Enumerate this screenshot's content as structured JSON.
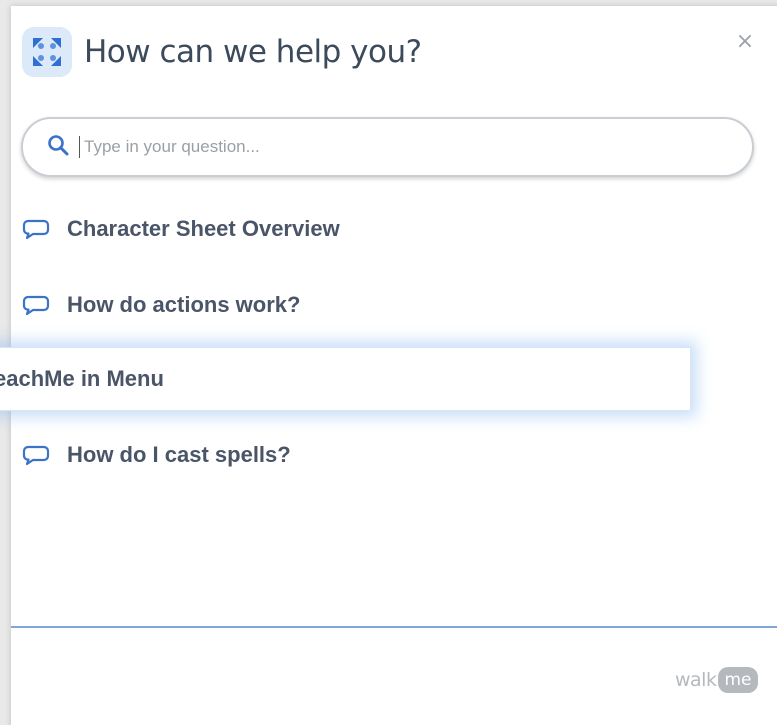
{
  "header": {
    "title": "How can we help you?",
    "close_label": "×"
  },
  "search": {
    "placeholder": "Type in your question...",
    "value": ""
  },
  "items": [
    {
      "label": "Character Sheet Overview"
    },
    {
      "label": "How do actions work?"
    },
    {
      "label": "eachMe in Menu"
    },
    {
      "label": "How do I cast spells?"
    }
  ],
  "footer": {
    "brand_walk": "walk",
    "brand_me": "me"
  },
  "colors": {
    "accent": "#3b73c9",
    "logo_bg": "#dce9f8",
    "divider": "#7ea6d8",
    "text": "#4a5568"
  },
  "icons": {
    "logo": "walkme-logo-icon",
    "close": "close-icon",
    "search": "search-icon",
    "item": "chat-bubble-icon"
  }
}
